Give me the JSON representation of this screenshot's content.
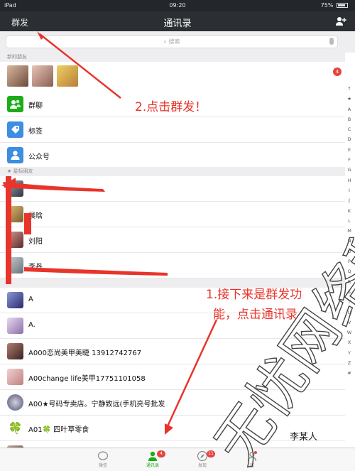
{
  "status": {
    "device": "iPad",
    "time": "09:20",
    "battery": "75%"
  },
  "nav": {
    "left_button": "群发",
    "title": "通讯录"
  },
  "search": {
    "placeholder": "搜索"
  },
  "sections": {
    "new_friends": "新的朋友",
    "starred": "★ 星标朋友",
    "a": "A"
  },
  "new_friends_badge": "4",
  "function_rows": [
    {
      "label": "群聊",
      "color": "#1aad19"
    },
    {
      "label": "标签",
      "color": "#3d8de0"
    },
    {
      "label": "公众号",
      "color": "#3d8de0"
    }
  ],
  "starred_contacts": [
    "",
    "晨晗",
    "刘阳",
    "李丹"
  ],
  "contacts": [
    "A",
    "A.",
    "A000恋尚美甲美睫 13912742767",
    "A00change life美甲17751101058",
    "A00★号码专卖店。宁静致远(手机亮号批发",
    "A01🍀 四叶草零食",
    ""
  ],
  "index_letters": [
    "↑",
    "★",
    "A",
    "B",
    "C",
    "D",
    "E",
    "F",
    "G",
    "H",
    "I",
    "J",
    "K",
    "L",
    "M",
    "N",
    "O",
    "P",
    "Q",
    "R",
    "S",
    "T",
    "U",
    "V",
    "W",
    "X",
    "Y",
    "Z",
    "#"
  ],
  "tabs": [
    {
      "label": "微信",
      "badge": ""
    },
    {
      "label": "通讯录",
      "badge": "4"
    },
    {
      "label": "发现",
      "badge": "11"
    },
    {
      "label": "我",
      "badge": ""
    }
  ],
  "annotations": {
    "step2": "2.点击群发！",
    "step1_line1": "1.接下来是群发功",
    "step1_line2": "能，点击通讯录",
    "watermark": "无忧网络科技",
    "author": "李某人"
  },
  "colors": {
    "accent": "#1aad19",
    "annotation": "#e8342b",
    "nav": "#2b2e33"
  }
}
